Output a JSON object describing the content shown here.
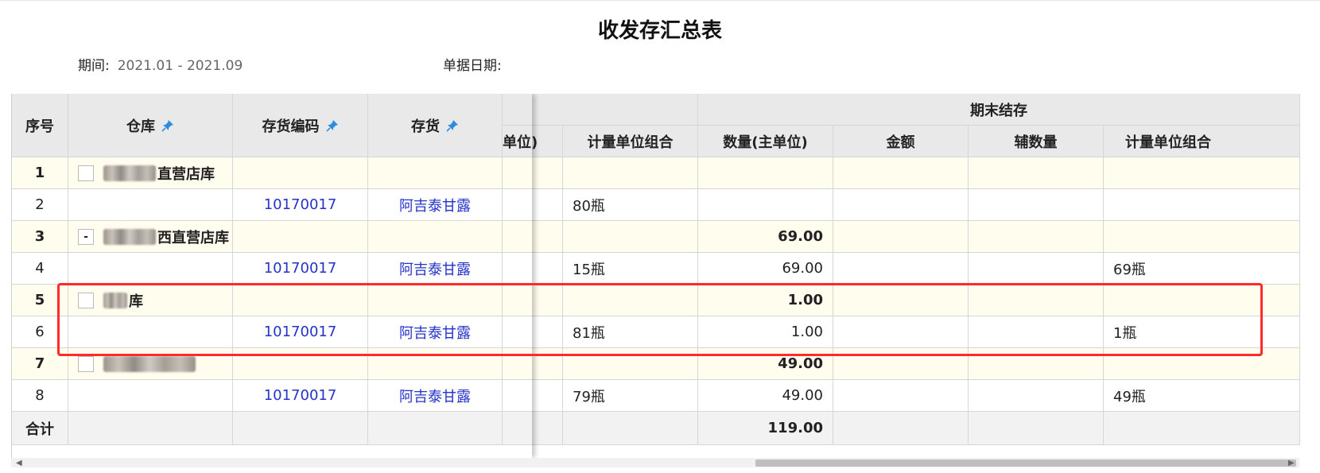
{
  "report": {
    "title": "收发存汇总表",
    "period_label": "期间:",
    "period_value": "2021.01 - 2021.09",
    "doc_date_label": "单据日期:"
  },
  "headers": {
    "seq": "序号",
    "warehouse": "仓库",
    "item_code": "存货编码",
    "item": "存货",
    "partial_unit": "单位)",
    "unit_combo": "计量单位组合",
    "ending_group": "期末结存",
    "qty_main": "数量(主单位)",
    "amount": "金额",
    "aux_qty": "辅数量",
    "unit_combo2": "计量单位组合"
  },
  "rows": [
    {
      "seq": "1",
      "level": "group",
      "warehouse": "直营店库",
      "toggle": "",
      "code": "",
      "item": "",
      "unit_combo": "",
      "qty": "",
      "end_unit_combo": ""
    },
    {
      "seq": "2",
      "level": "detail",
      "warehouse": "",
      "toggle": "",
      "code": "10170017",
      "item": "阿吉泰甘露",
      "unit_combo": "80瓶",
      "qty": "",
      "end_unit_combo": ""
    },
    {
      "seq": "3",
      "level": "group",
      "warehouse": "西直营店库",
      "toggle": "-",
      "code": "",
      "item": "",
      "unit_combo": "",
      "qty": "69.00",
      "end_unit_combo": ""
    },
    {
      "seq": "4",
      "level": "detail",
      "warehouse": "",
      "toggle": "",
      "code": "10170017",
      "item": "阿吉泰甘露",
      "unit_combo": "15瓶",
      "qty": "69.00",
      "end_unit_combo": "69瓶"
    },
    {
      "seq": "5",
      "level": "group",
      "warehouse": "库",
      "toggle": "",
      "code": "",
      "item": "",
      "unit_combo": "",
      "qty": "1.00",
      "end_unit_combo": ""
    },
    {
      "seq": "6",
      "level": "detail",
      "warehouse": "",
      "toggle": "",
      "code": "10170017",
      "item": "阿吉泰甘露",
      "unit_combo": "81瓶",
      "qty": "1.00",
      "end_unit_combo": "1瓶"
    },
    {
      "seq": "7",
      "level": "group",
      "warehouse": "",
      "toggle": "",
      "code": "",
      "item": "",
      "unit_combo": "",
      "qty": "49.00",
      "end_unit_combo": ""
    },
    {
      "seq": "8",
      "level": "detail",
      "warehouse": "",
      "toggle": "",
      "code": "10170017",
      "item": "阿吉泰甘露",
      "unit_combo": "79瓶",
      "qty": "49.00",
      "end_unit_combo": "49瓶"
    }
  ],
  "totals": {
    "label": "合计",
    "qty": "119.00"
  },
  "colors": {
    "accent_link": "#2433c9",
    "highlight_box": "#ff2a2a",
    "group_row_bg": "#fffdee",
    "header_bg": "#e9e9e9"
  },
  "icons": {
    "pin": "pin-icon"
  }
}
